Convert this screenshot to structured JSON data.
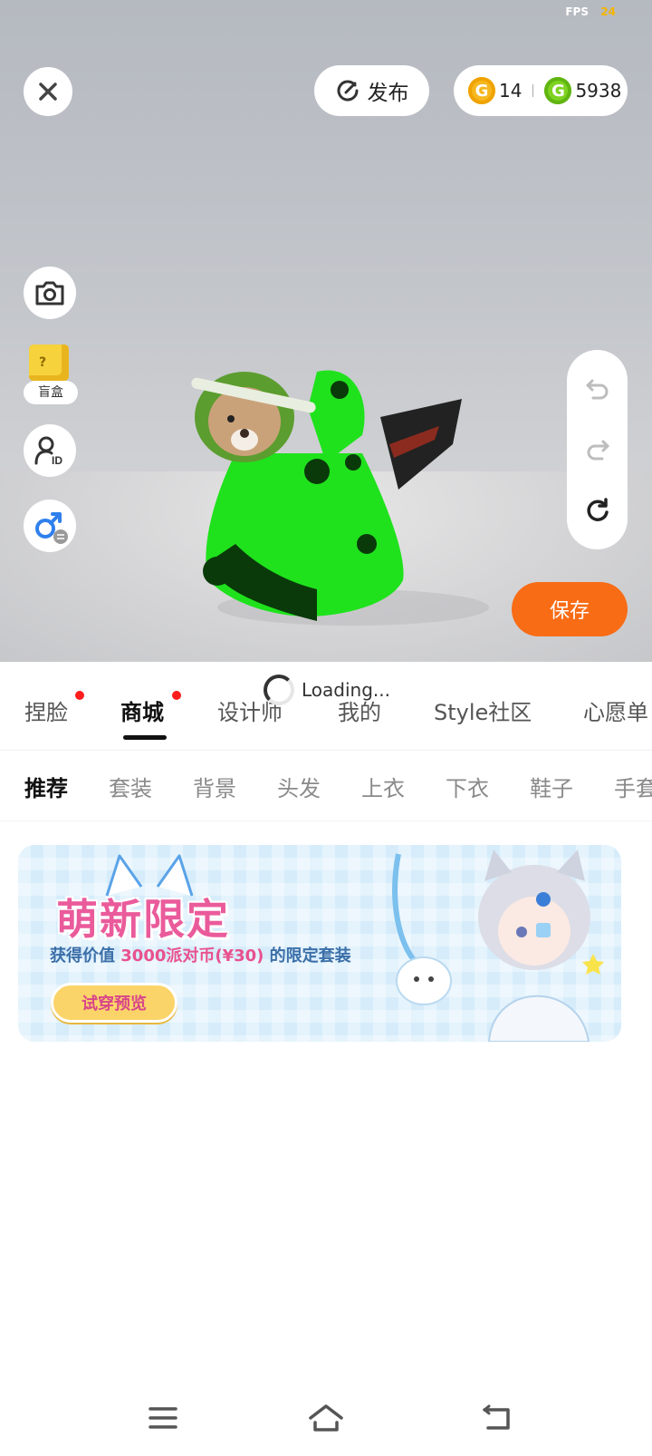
{
  "status": {
    "fps_label": "FPS",
    "fps_value": "24"
  },
  "header": {
    "publish_label": "发布",
    "coins": {
      "gold": "14",
      "green": "5938"
    }
  },
  "side": {
    "blind_box_label": "盲盒"
  },
  "save_label": "保存",
  "tabs": [
    {
      "label": "捏脸",
      "dot": true
    },
    {
      "label": "商城",
      "dot": true,
      "active": true
    },
    {
      "label": "设计师"
    },
    {
      "label": "我的"
    },
    {
      "label": "Style社区"
    },
    {
      "label": "心愿单"
    }
  ],
  "loading_text": "Loading...",
  "subtabs": [
    {
      "label": "推荐",
      "active": true
    },
    {
      "label": "套装"
    },
    {
      "label": "背景"
    },
    {
      "label": "头发"
    },
    {
      "label": "上衣"
    },
    {
      "label": "下衣"
    },
    {
      "label": "鞋子"
    },
    {
      "label": "手套"
    }
  ],
  "banner": {
    "title": "萌新限定",
    "subtitle_pre": "获得价值 ",
    "subtitle_highlight": "3000派对币(¥30)",
    "subtitle_post": " 的限定套装",
    "button_label": "试穿预览"
  },
  "colors": {
    "accent": "#f86c16",
    "dot": "#ff1d1d",
    "banner_pink": "#ea5b9b"
  }
}
